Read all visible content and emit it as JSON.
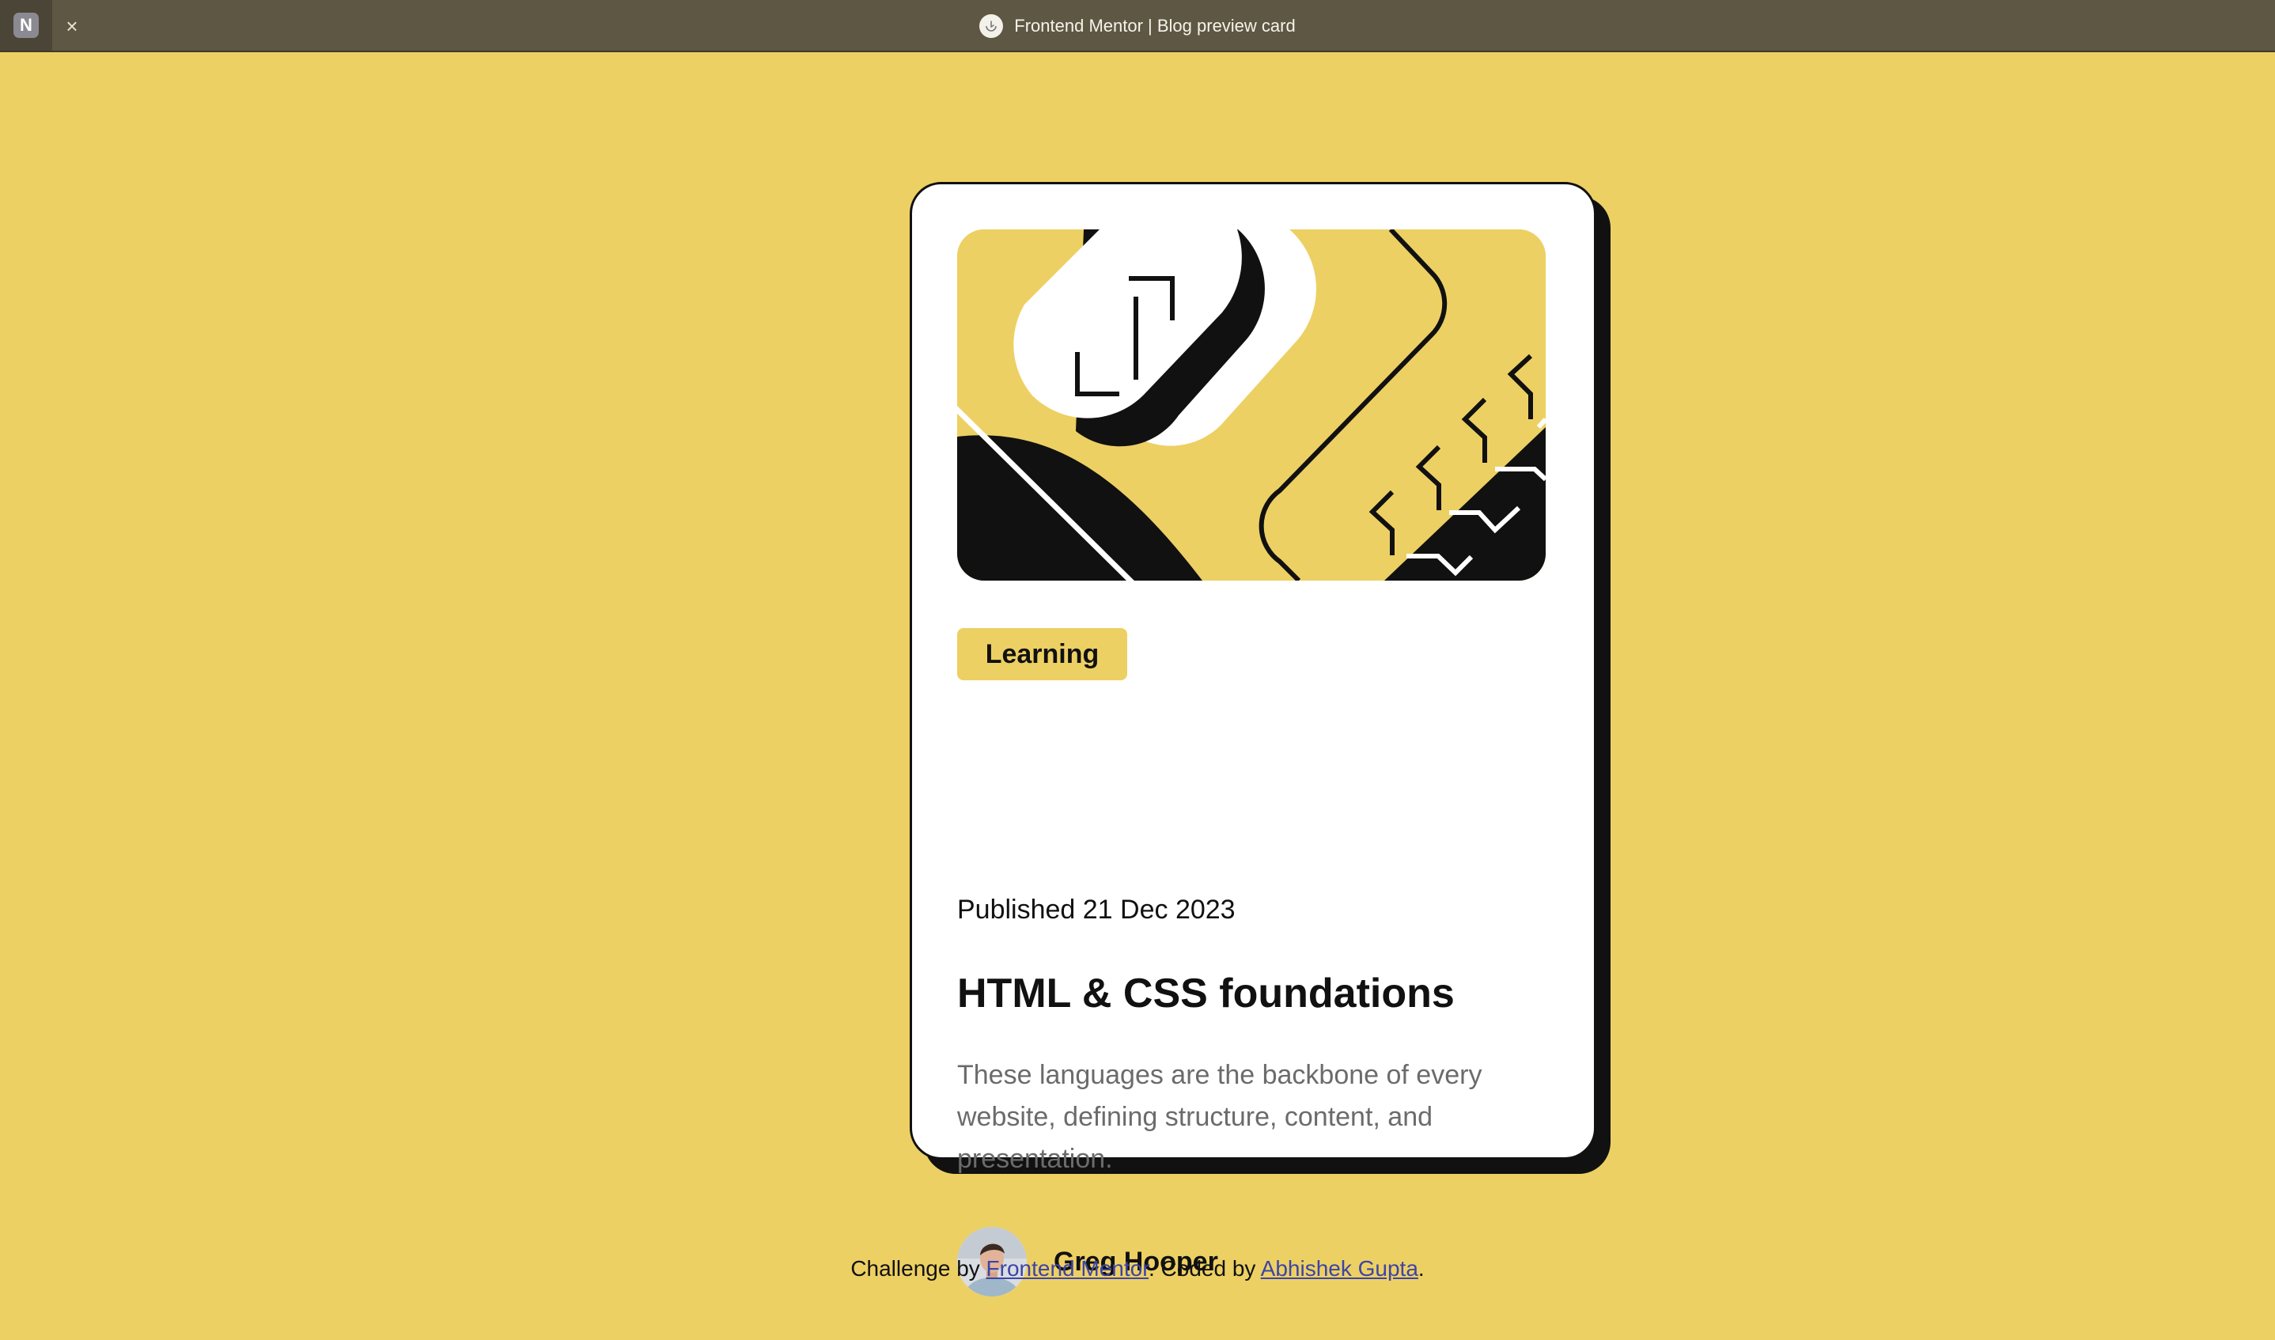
{
  "browser": {
    "app_icon_letter": "N",
    "close_symbol": "×",
    "tab_title": "Frontend Mentor | Blog preview card"
  },
  "card": {
    "tag": "Learning",
    "published": "Published 21 Dec 2023",
    "title": "HTML & CSS foundations",
    "description": "These languages are the backbone of every website, defining structure, content, and presentation.",
    "author": "Greg Hooper"
  },
  "footer": {
    "prefix": "Challenge by ",
    "link1": "Frontend Mentor",
    "middle": ". Coded by ",
    "link2": "Abhishek Gupta",
    "suffix": "."
  },
  "colors": {
    "background": "#EDD063",
    "ink": "#111111",
    "card": "#FFFFFF",
    "muted_text": "#6B6B6B",
    "link": "#3D44A7"
  }
}
